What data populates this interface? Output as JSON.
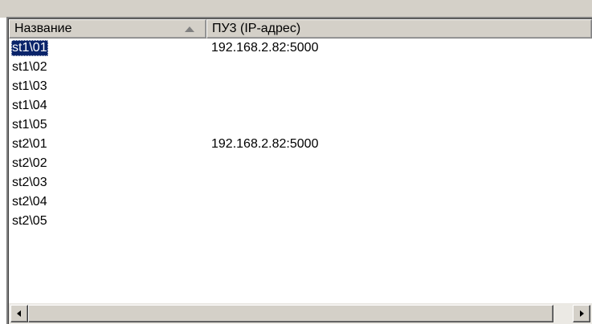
{
  "listview": {
    "columns": [
      {
        "label": "Название",
        "sorted": "ascending"
      },
      {
        "label": "ПУ3 (IP-адрес)"
      }
    ],
    "rows": [
      {
        "name": "st1\\01",
        "address": "192.168.2.82:5000",
        "selected": true
      },
      {
        "name": "st1\\02",
        "address": ""
      },
      {
        "name": "st1\\03",
        "address": ""
      },
      {
        "name": "st1\\04",
        "address": ""
      },
      {
        "name": "st1\\05",
        "address": ""
      },
      {
        "name": "st2\\01",
        "address": "192.168.2.82:5000"
      },
      {
        "name": "st2\\02",
        "address": ""
      },
      {
        "name": "st2\\03",
        "address": ""
      },
      {
        "name": "st2\\04",
        "address": ""
      },
      {
        "name": "st2\\05",
        "address": ""
      }
    ]
  },
  "scrollbar": {
    "left_icon": "arrow-left-icon",
    "right_icon": "arrow-right-icon"
  },
  "colors": {
    "selection": "#0a246a",
    "face": "#d4d0c8"
  }
}
